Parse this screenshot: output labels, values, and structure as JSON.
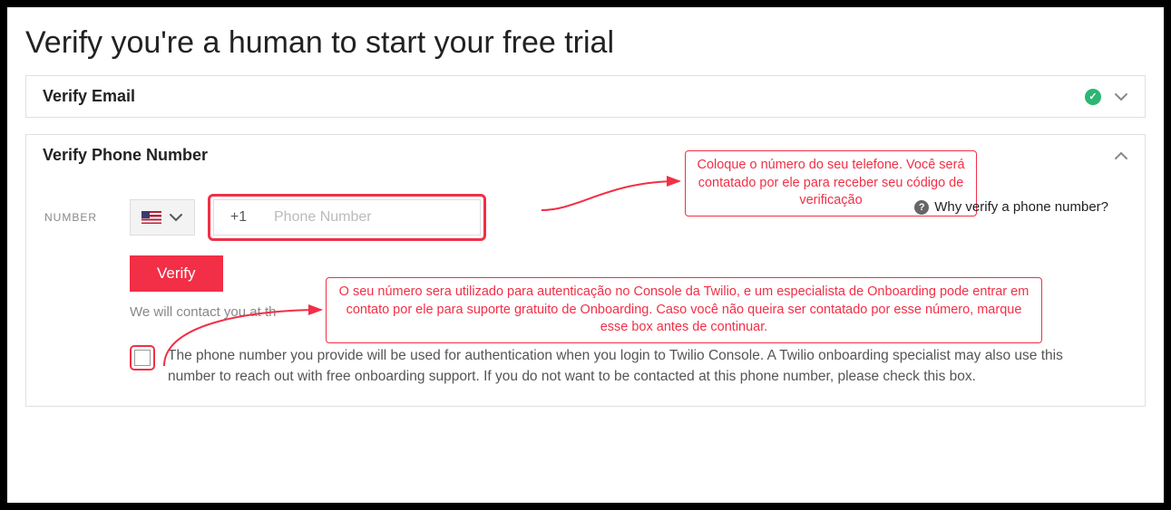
{
  "page_title": "Verify you're a human to start your free trial",
  "sections": {
    "email": {
      "title": "Verify Email",
      "completed": true,
      "expanded": false
    },
    "phone": {
      "title": "Verify Phone Number",
      "expanded": true,
      "field_label": "NUMBER",
      "country_code": "+1",
      "phone_placeholder": "Phone Number",
      "verify_button": "Verify",
      "contact_note": "We will contact you at th",
      "help_link": "Why verify a phone number?",
      "consent_text": "The phone number you provide will be used for authentication when you login to Twilio Console. A Twilio onboarding specialist may also use this number to reach out with free onboarding support. If you do not want to be contacted at this phone number, please check this box."
    }
  },
  "annotations": {
    "top": "Coloque o número do seu telefone. Você será contatado por ele para receber seu código de verificação",
    "middle": "O seu número sera utilizado para autenticação no Console da Twilio, e um especialista de Onboarding pode entrar em contato por ele para suporte gratuito de Onboarding. Caso você não queira ser contatado por esse número, marque esse box antes de continuar."
  },
  "colors": {
    "accent": "#f22f46",
    "success": "#2bb673"
  }
}
